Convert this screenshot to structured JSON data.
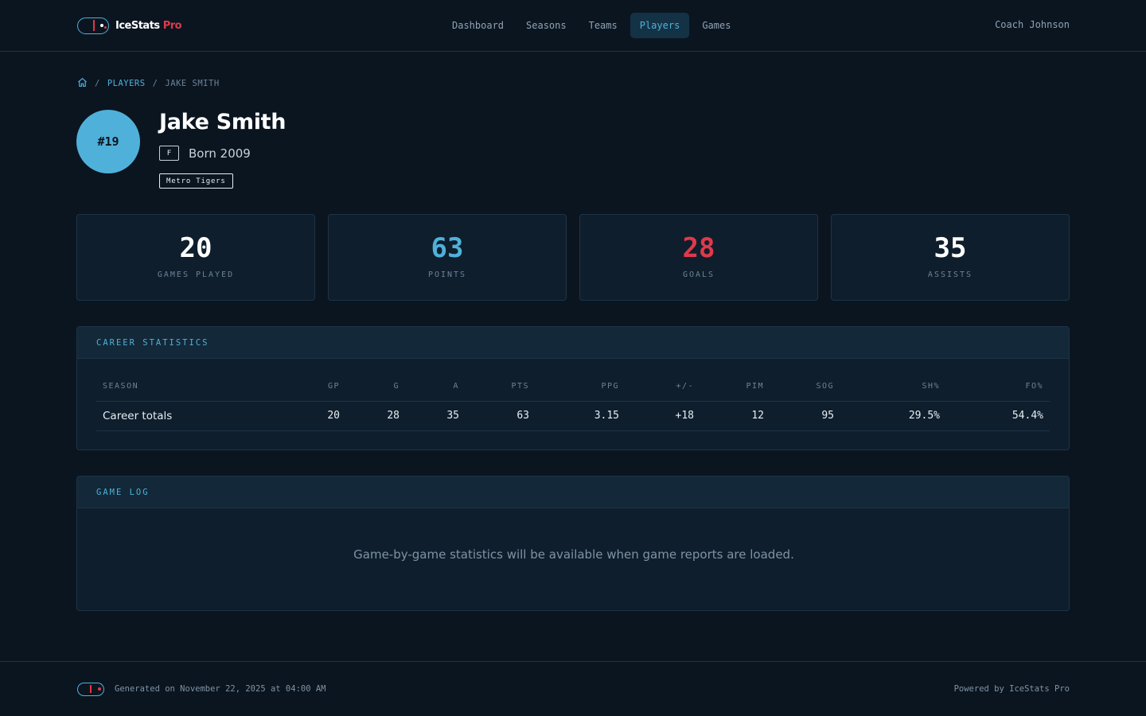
{
  "brand": {
    "name_main": "IceStats",
    "name_suffix": " Pro"
  },
  "nav": {
    "items": [
      {
        "label": "Dashboard"
      },
      {
        "label": "Seasons"
      },
      {
        "label": "Teams"
      },
      {
        "label": "Players",
        "active": true
      },
      {
        "label": "Games"
      }
    ]
  },
  "user": {
    "name": "Coach Johnson"
  },
  "breadcrumb": {
    "sep": "/",
    "parent": "PLAYERS",
    "current": "JAKE SMITH"
  },
  "player": {
    "number": "#19",
    "name": "Jake Smith",
    "position": "F",
    "born": "Born 2009",
    "team": "Metro Tigers"
  },
  "stat_cards": [
    {
      "value": "20",
      "label": "GAMES PLAYED",
      "color": "#ffffff"
    },
    {
      "value": "63",
      "label": "POINTS",
      "color": "#4fb1da"
    },
    {
      "value": "28",
      "label": "GOALS",
      "color": "#e0394a"
    },
    {
      "value": "35",
      "label": "ASSISTS",
      "color": "#ffffff"
    }
  ],
  "career": {
    "title": "CAREER STATISTICS",
    "columns": [
      "SEASON",
      "GP",
      "G",
      "A",
      "PTS",
      "PPG",
      "+/-",
      "PIM",
      "SOG",
      "SH%",
      "FO%"
    ],
    "rows": [
      [
        "Career totals",
        "20",
        "28",
        "35",
        "63",
        "3.15",
        "+18",
        "12",
        "95",
        "29.5%",
        "54.4%"
      ]
    ]
  },
  "game_log": {
    "title": "GAME LOG",
    "empty_message": "Game-by-game statistics will be available when game reports are loaded."
  },
  "footer": {
    "generated": "Generated on November 22, 2025 at 04:00 AM",
    "powered": "Powered by IceStats Pro"
  }
}
